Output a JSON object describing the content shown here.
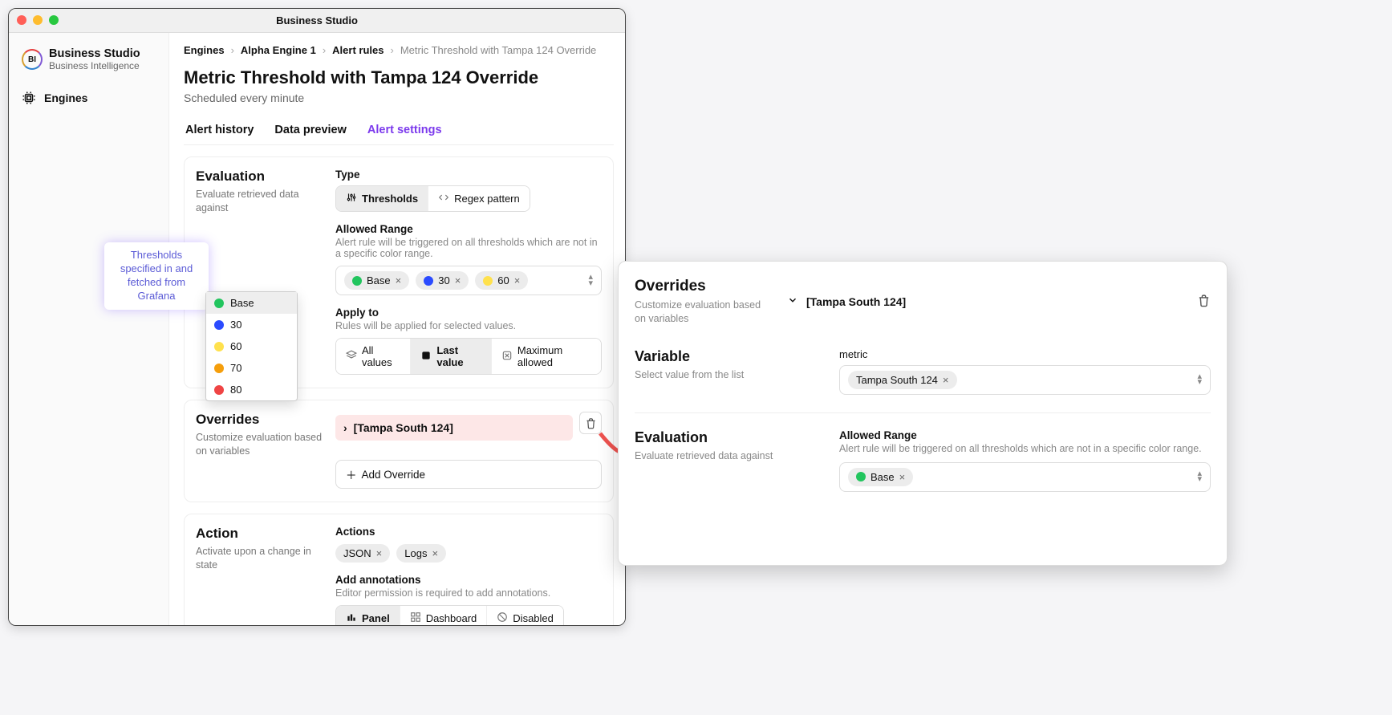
{
  "window_title": "Business Studio",
  "brand": {
    "name": "Business Studio",
    "sub": "Business Intelligence",
    "logo_text": "BI"
  },
  "sidebar": {
    "items": [
      {
        "label": "Engines"
      }
    ]
  },
  "breadcrumbs": {
    "items": [
      "Engines",
      "Alpha Engine 1",
      "Alert rules"
    ],
    "current": "Metric Threshold with Tampa 124 Override"
  },
  "page": {
    "title": "Metric Threshold with Tampa 124 Override",
    "subtitle": "Scheduled every minute"
  },
  "tabs": {
    "items": [
      "Alert history",
      "Data preview",
      "Alert settings"
    ],
    "active": 2
  },
  "evaluation": {
    "heading": "Evaluation",
    "sub": "Evaluate retrieved data against",
    "type_label": "Type",
    "type_options": [
      "Thresholds",
      "Regex pattern"
    ],
    "type_active": 0,
    "range_label": "Allowed Range",
    "range_help": "Alert rule will be triggered on all thresholds which are not in a specific color range.",
    "range_chips": [
      {
        "label": "Base",
        "color": "#22c55e"
      },
      {
        "label": "30",
        "color": "#2b4bff"
      },
      {
        "label": "60",
        "color": "#ffe14d"
      }
    ],
    "applyto_label": "Apply to",
    "applyto_help": "Rules will be applied for selected values.",
    "applyto_options": [
      "All values",
      "Last value",
      "Maximum allowed"
    ],
    "applyto_active": 1
  },
  "threshold_popover": {
    "note": "Thresholds specified in and fetched from Grafana",
    "options": [
      {
        "label": "Base",
        "color": "#22c55e",
        "selected": true
      },
      {
        "label": "30",
        "color": "#2b4bff"
      },
      {
        "label": "60",
        "color": "#ffe14d"
      },
      {
        "label": "70",
        "color": "#f59e0b"
      },
      {
        "label": "80",
        "color": "#ef4444"
      }
    ]
  },
  "overrides": {
    "heading": "Overrides",
    "sub": "Customize evaluation based on variables",
    "row_label": "[Tampa South 124]",
    "add_label": "Add Override"
  },
  "action": {
    "heading": "Action",
    "sub": "Activate upon a change in state",
    "actions_label": "Actions",
    "action_chips": [
      "JSON",
      "Logs"
    ],
    "annotations_label": "Add annotations",
    "annotations_help": "Editor permission is required to add annotations.",
    "annotations_options": [
      "Panel",
      "Dashboard",
      "Disabled"
    ],
    "annotations_active": 0
  },
  "detail": {
    "heading": "Overrides",
    "sub": "Customize evaluation based on variables",
    "row_label": "[Tampa South 124]",
    "variable_heading": "Variable",
    "variable_sub": "Select value from the list",
    "metric_label": "metric",
    "metric_chip": "Tampa South 124",
    "eval_heading": "Evaluation",
    "eval_sub": "Evaluate retrieved data against",
    "range_label": "Allowed Range",
    "range_help": "Alert rule will be triggered on all thresholds which are not in a specific color range.",
    "range_chip": {
      "label": "Base",
      "color": "#22c55e"
    }
  }
}
